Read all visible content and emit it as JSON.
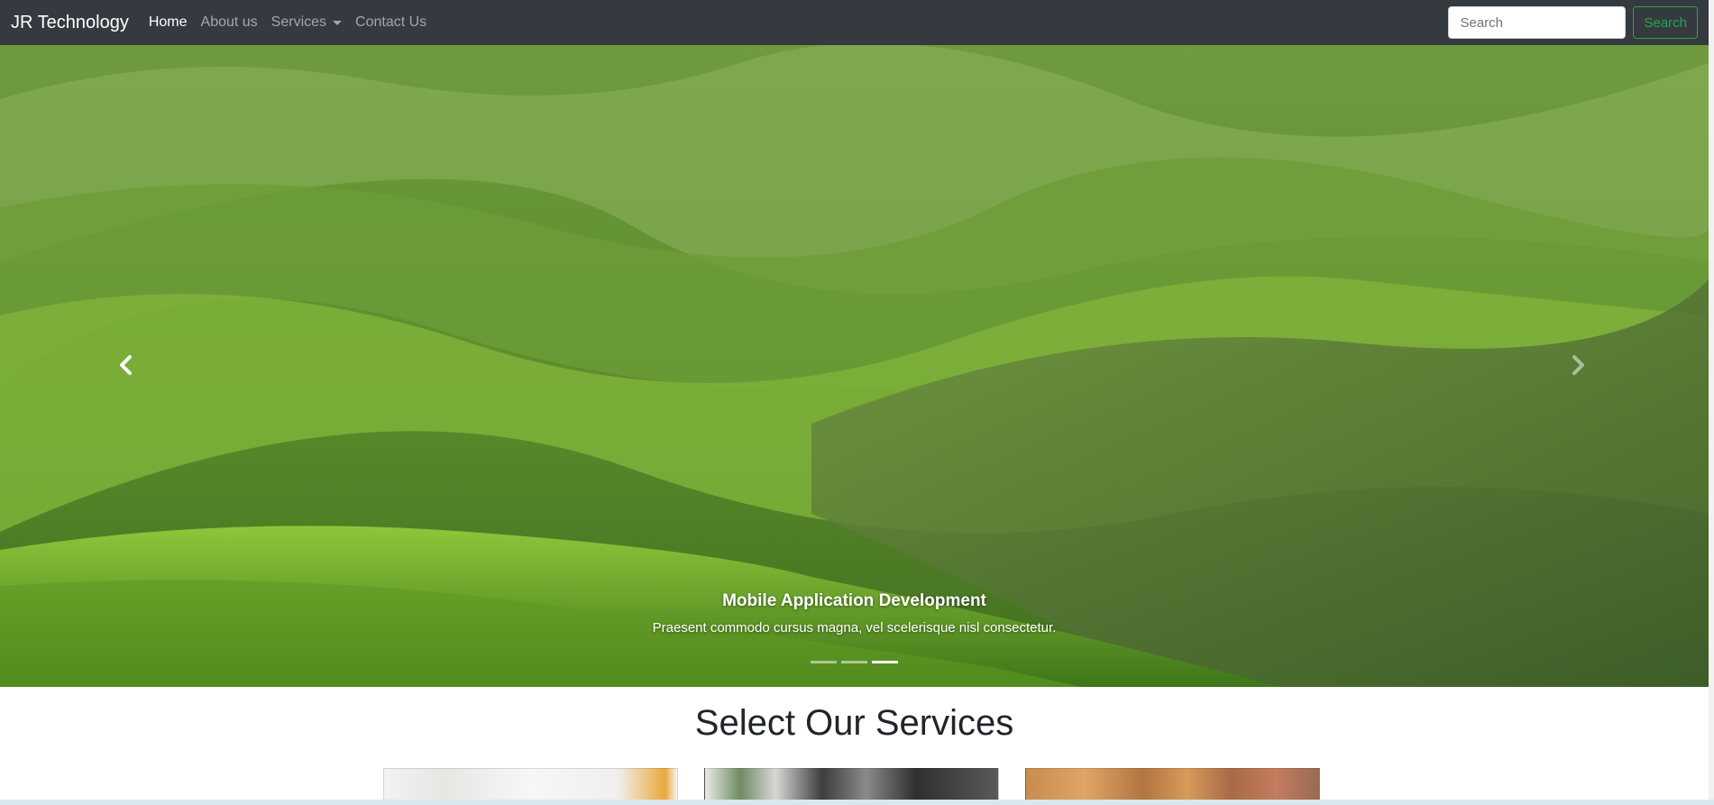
{
  "navbar": {
    "brand": "JR Technology",
    "links": [
      {
        "label": "Home",
        "active": true
      },
      {
        "label": "About us"
      },
      {
        "label": "Services",
        "dropdown": true
      },
      {
        "label": "Contact Us"
      }
    ],
    "search": {
      "placeholder": "Search",
      "button_label": "Search"
    },
    "colors": {
      "background": "#343a40",
      "search_button": "#28a745"
    }
  },
  "carousel": {
    "caption_title": "Mobile Application Development",
    "caption_text": "Praesent commodo cursus magna, vel scelerisque nisl consectetur.",
    "slide_count": 3,
    "active_index": 2,
    "prev_icon": "chevron-left-icon",
    "next_icon": "chevron-right-icon"
  },
  "services": {
    "title": "Select Our Services"
  }
}
